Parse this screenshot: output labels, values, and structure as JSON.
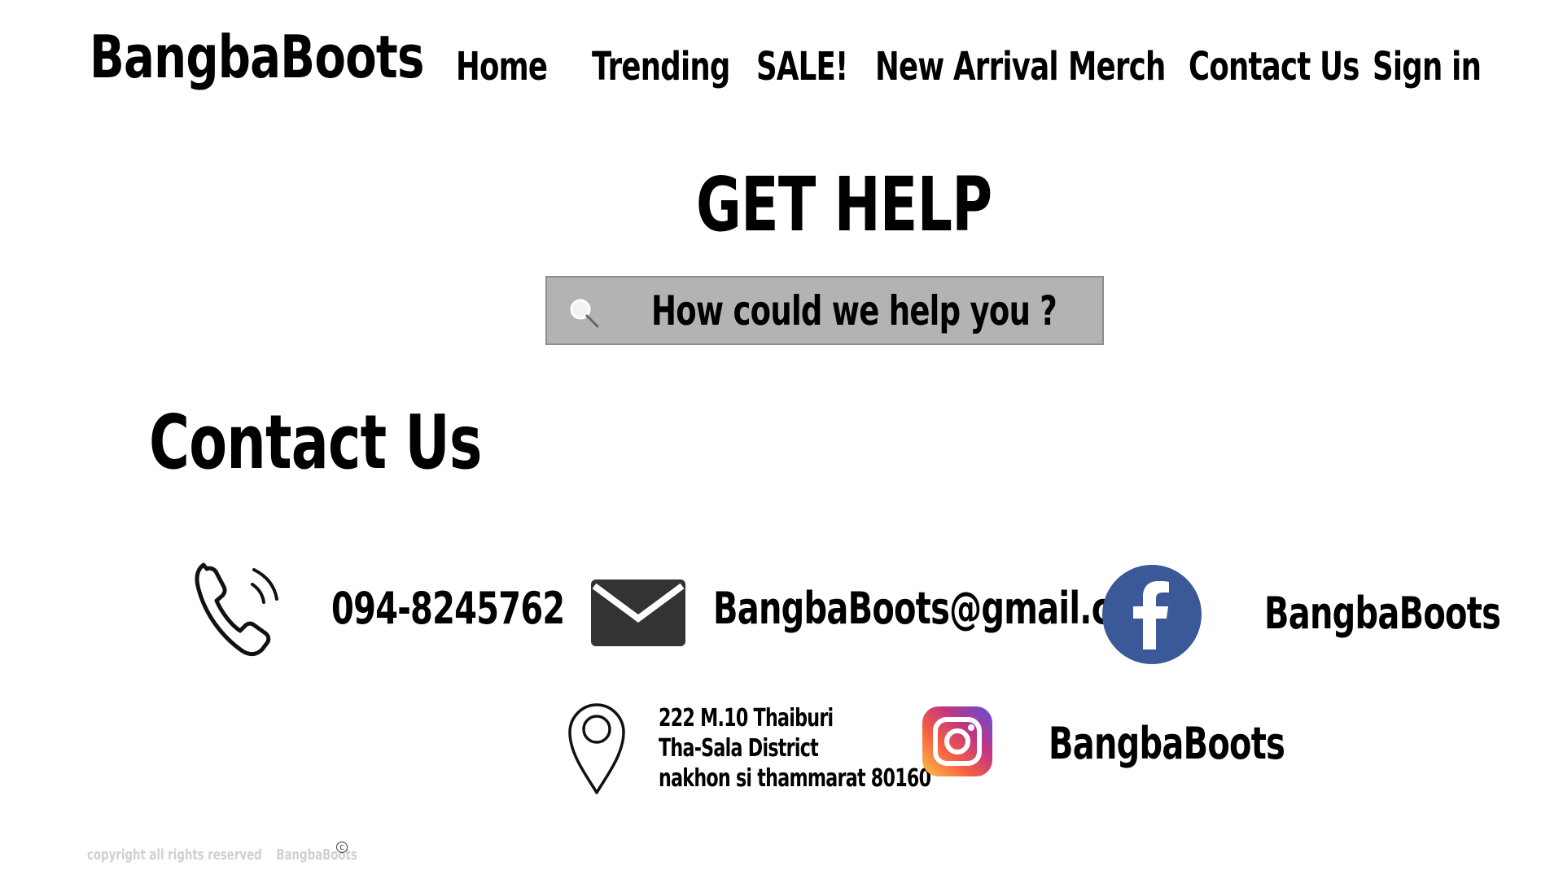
{
  "header": {
    "logo": "BangbaBoots",
    "nav": [
      {
        "label": "Home"
      },
      {
        "label": "Trending"
      },
      {
        "label": "SALE!"
      },
      {
        "label": "New Arrival"
      },
      {
        "label": "Merch"
      },
      {
        "label": "Contact Us"
      },
      {
        "label": "Sign in"
      }
    ]
  },
  "help": {
    "title": "GET HELP",
    "search_placeholder": "How could we help you ?",
    "search_icon": "search-icon",
    "search_bg": "#b3b3b3"
  },
  "contact": {
    "title": "Contact Us",
    "phone": "094-8245762",
    "email": "BangbaBoots@gmail.com",
    "facebook": "BangbaBoots",
    "address_lines": [
      "222 M.10 Thaiburi",
      "Tha-Sala District",
      "nakhon si thammarat 80160"
    ],
    "instagram": "BangbaBoots",
    "facebook_color": "#3b5998"
  },
  "footer": {
    "copyright": "copyright all rights reserved",
    "brand": "BangbaBoots",
    "mark": "c"
  }
}
